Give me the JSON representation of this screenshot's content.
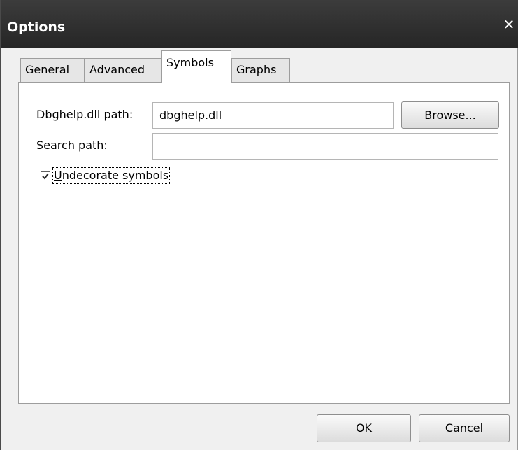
{
  "window": {
    "title": "Options"
  },
  "tabs": [
    {
      "label": "General"
    },
    {
      "label": "Advanced"
    },
    {
      "label": "Symbols",
      "active": true
    },
    {
      "label": "Graphs"
    }
  ],
  "symbols": {
    "dbghelp_label": "Dbghelp.dll path:",
    "dbghelp_value": "dbghelp.dll",
    "browse_label": "Browse...",
    "search_label": "Search path:",
    "search_value": "",
    "undecorate_accel": "U",
    "undecorate_rest": "ndecorate symbols",
    "undecorate_checked": true
  },
  "buttons": {
    "ok": "OK",
    "cancel": "Cancel"
  },
  "icons": {
    "close": "close-icon",
    "check": "checkmark-icon"
  }
}
